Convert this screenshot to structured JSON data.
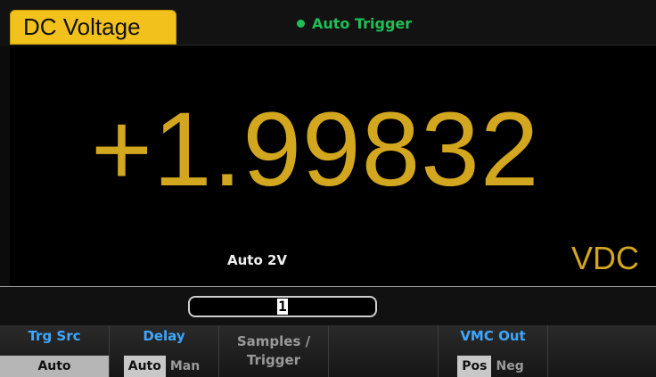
{
  "header": {
    "mode_tab": "DC Voltage",
    "trigger_status": "Auto Trigger"
  },
  "display": {
    "reading": "+1.99832",
    "range": "Auto 2V",
    "unit": "VDC"
  },
  "input": {
    "value": "1"
  },
  "softkeys": {
    "trg_src": {
      "title": "Trg Src",
      "value": "Auto"
    },
    "delay": {
      "title": "Delay",
      "options": [
        "Auto",
        "Man"
      ],
      "selected": "Auto"
    },
    "samples": {
      "line1": "Samples /",
      "line2": "Trigger"
    },
    "vmc_out": {
      "title": "VMC Out",
      "options": [
        "Pos",
        "Neg"
      ],
      "selected": "Pos"
    }
  },
  "colors": {
    "accent_yellow": "#f2c11b",
    "reading": "#d2a61e",
    "trigger_green": "#1fbf54",
    "softkey_title_blue": "#3ea7ff"
  }
}
